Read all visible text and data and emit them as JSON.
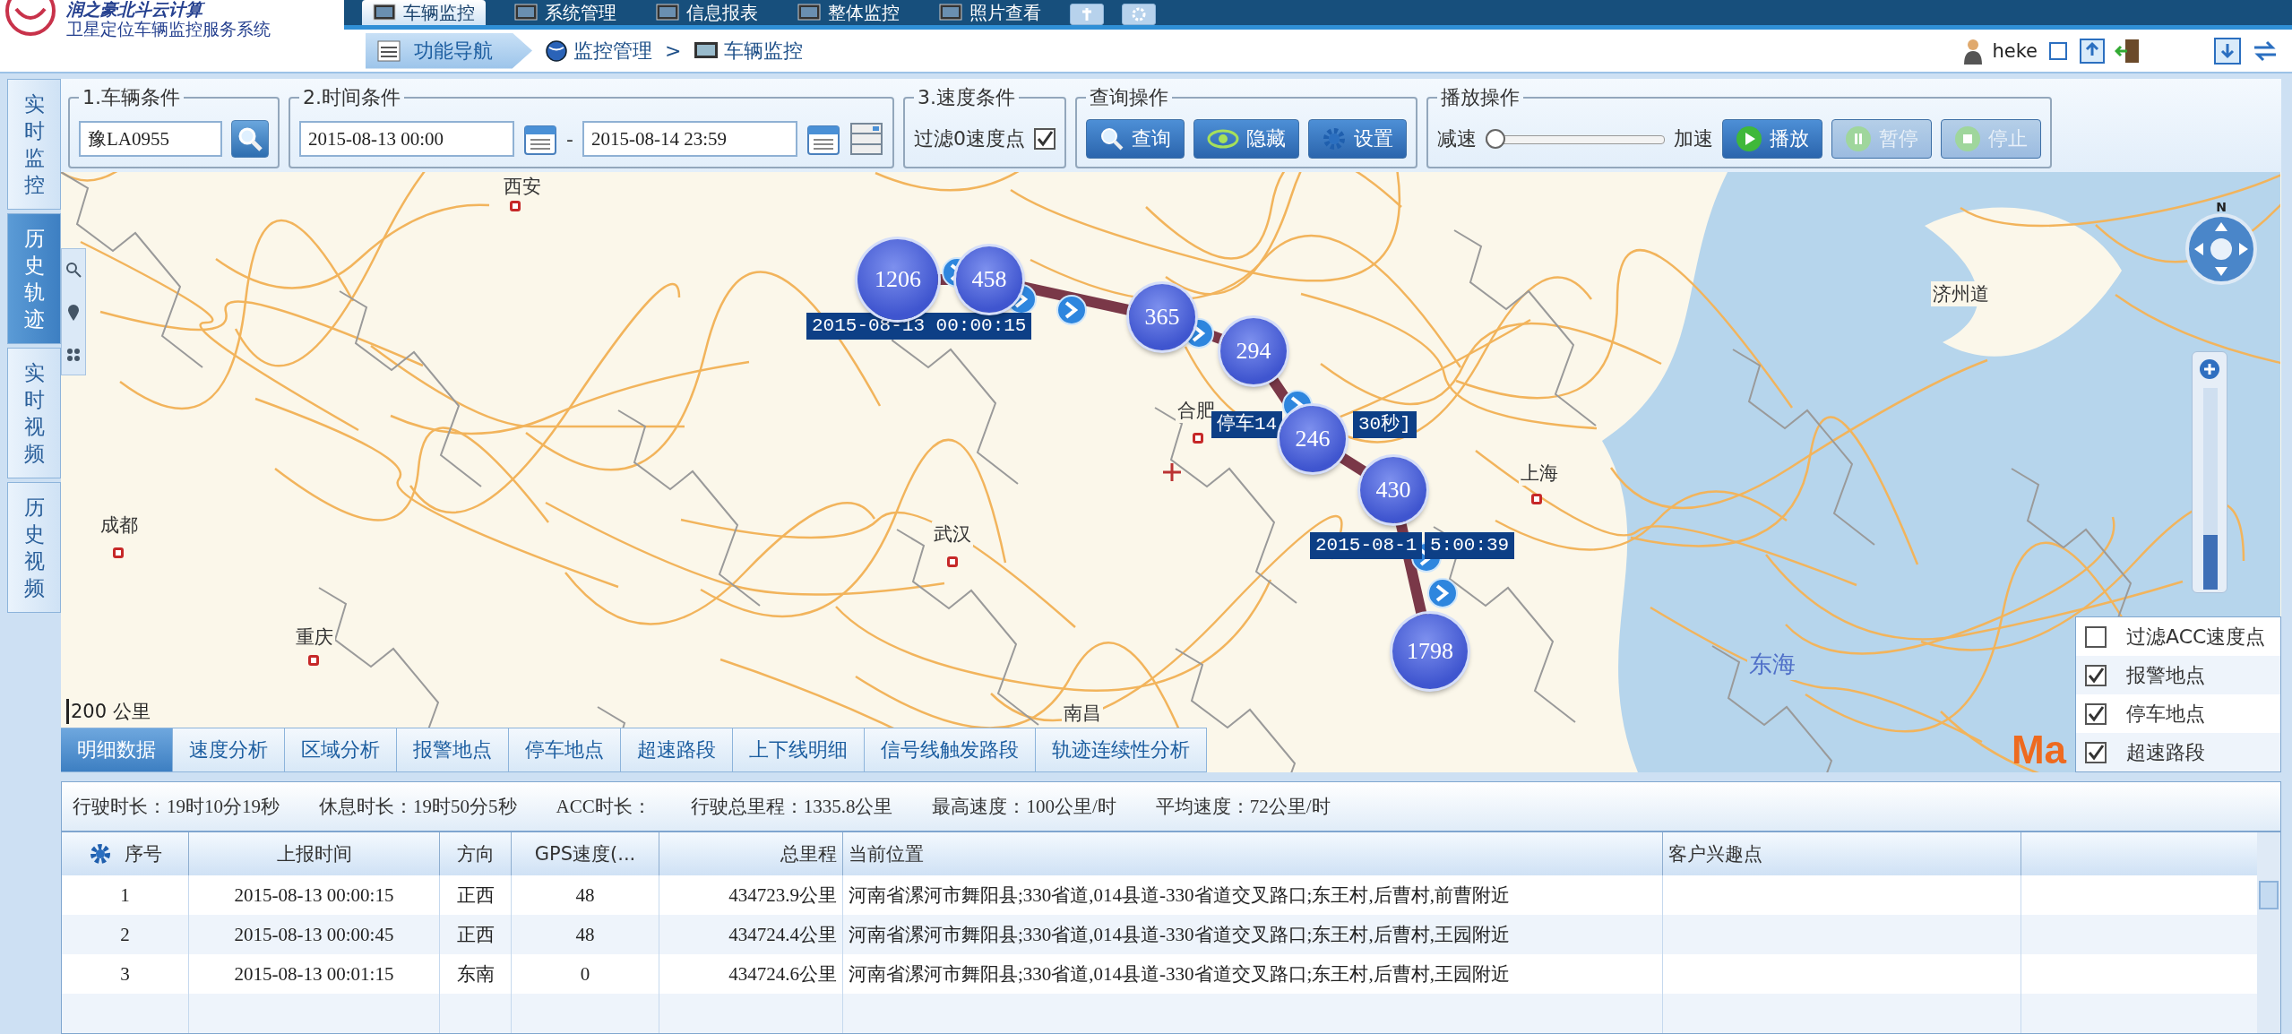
{
  "header": {
    "logo_title": "润之豪北斗云计算",
    "logo_subtitle": "卫星定位车辆监控服务系统",
    "menu": [
      {
        "label": "车辆监控",
        "selected": true
      },
      {
        "label": "系统管理",
        "selected": false
      },
      {
        "label": "信息报表",
        "selected": false
      },
      {
        "label": "整体监控",
        "selected": false
      },
      {
        "label": "照片查看",
        "selected": false
      }
    ]
  },
  "breadcrumb": {
    "nav_button": "功能导航",
    "path": [
      "监控管理",
      "车辆监控"
    ],
    "separator": ">"
  },
  "user": {
    "name": "heke"
  },
  "side_tabs": [
    {
      "label": "实时监控",
      "selected": false
    },
    {
      "label": "历史轨迹",
      "selected": true
    },
    {
      "label": "实时视频",
      "selected": false
    },
    {
      "label": "历史视频",
      "selected": false
    }
  ],
  "filters": {
    "vehicle": {
      "legend": "1.车辆条件",
      "value": "豫LA0955"
    },
    "time": {
      "legend": "2.时间条件",
      "start": "2015-08-13 00:00",
      "separator": "-",
      "end": "2015-08-14 23:59"
    },
    "speed": {
      "legend": "3.速度条件",
      "label": "过滤0速度点",
      "checked": true
    },
    "query": {
      "legend": "查询操作",
      "buttons": [
        {
          "label": "查询",
          "kind": "search"
        },
        {
          "label": "隐藏",
          "kind": "eye"
        },
        {
          "label": "设置",
          "kind": "gear"
        }
      ]
    },
    "playback": {
      "legend": "播放操作",
      "slower": "减速",
      "faster": "加速",
      "level": 0,
      "buttons": [
        {
          "label": "播放",
          "kind": "play",
          "disabled": false
        },
        {
          "label": "暂停",
          "kind": "pause",
          "disabled": true
        },
        {
          "label": "停止",
          "kind": "stop",
          "disabled": true
        }
      ]
    }
  },
  "map": {
    "places": [
      {
        "name": "西安",
        "kind": "city"
      },
      {
        "name": "成都",
        "kind": "city"
      },
      {
        "name": "重庆",
        "kind": "city"
      },
      {
        "name": "武汉",
        "kind": "city"
      },
      {
        "name": "合肥",
        "kind": "city"
      },
      {
        "name": "上海",
        "kind": "city"
      },
      {
        "name": "南昌",
        "kind": "label"
      },
      {
        "name": "济州道",
        "kind": "label"
      },
      {
        "name": "东海",
        "kind": "sea"
      }
    ],
    "clusters": [
      {
        "count": "1206"
      },
      {
        "count": "458"
      },
      {
        "count": "365"
      },
      {
        "count": "294"
      },
      {
        "count": "246"
      },
      {
        "count": "430"
      },
      {
        "count": "1798"
      }
    ],
    "labels": [
      "2015-08-13 00:00:15",
      "停车14",
      "30秒]",
      "2015-08-1",
      "5:00:39"
    ],
    "scale": "200 公里",
    "zoom": {
      "level": 0.27
    },
    "compass": "N",
    "logo": "Ma",
    "layers": [
      {
        "label": "过滤ACC速度点",
        "checked": false
      },
      {
        "label": "报警地点",
        "checked": true
      },
      {
        "label": "停车地点",
        "checked": true
      },
      {
        "label": "超速路段",
        "checked": true
      }
    ]
  },
  "bottom_tabs": [
    {
      "label": "明细数据",
      "selected": true
    },
    {
      "label": "速度分析",
      "selected": false
    },
    {
      "label": "区域分析",
      "selected": false
    },
    {
      "label": "报警地点",
      "selected": false
    },
    {
      "label": "停车地点",
      "selected": false
    },
    {
      "label": "超速路段",
      "selected": false
    },
    {
      "label": "上下线明细",
      "selected": false
    },
    {
      "label": "信号线触发路段",
      "selected": false
    },
    {
      "label": "轨迹连续性分析",
      "selected": false
    }
  ],
  "summary": [
    "行驶时长：19时10分19秒",
    "休息时长：19时50分5秒",
    "ACC时长：",
    "行驶总里程：1335.8公里",
    "最高速度：100公里/时",
    "平均速度：72公里/时"
  ],
  "table": {
    "columns": [
      "序号",
      "上报时间",
      "方向",
      "GPS速度(...",
      "总里程",
      "当前位置",
      "客户兴趣点"
    ],
    "rows": [
      [
        "1",
        "2015-08-13 00:00:15",
        "正西",
        "48",
        "434723.9公里",
        "河南省漯河市舞阳县;330省道,014县道-330省道交叉路口;东王村,后曹村,前曹附近"
      ],
      [
        "2",
        "2015-08-13 00:00:45",
        "正西",
        "48",
        "434724.4公里",
        "河南省漯河市舞阳县;330省道,014县道-330省道交叉路口;东王村,后曹村,王园附近"
      ],
      [
        "3",
        "2015-08-13 00:01:15",
        "东南",
        "0",
        "434724.6公里",
        "河南省漯河市舞阳县;330省道,014县道-330省道交叉路口;东王村,后曹村,王园附近"
      ]
    ]
  }
}
